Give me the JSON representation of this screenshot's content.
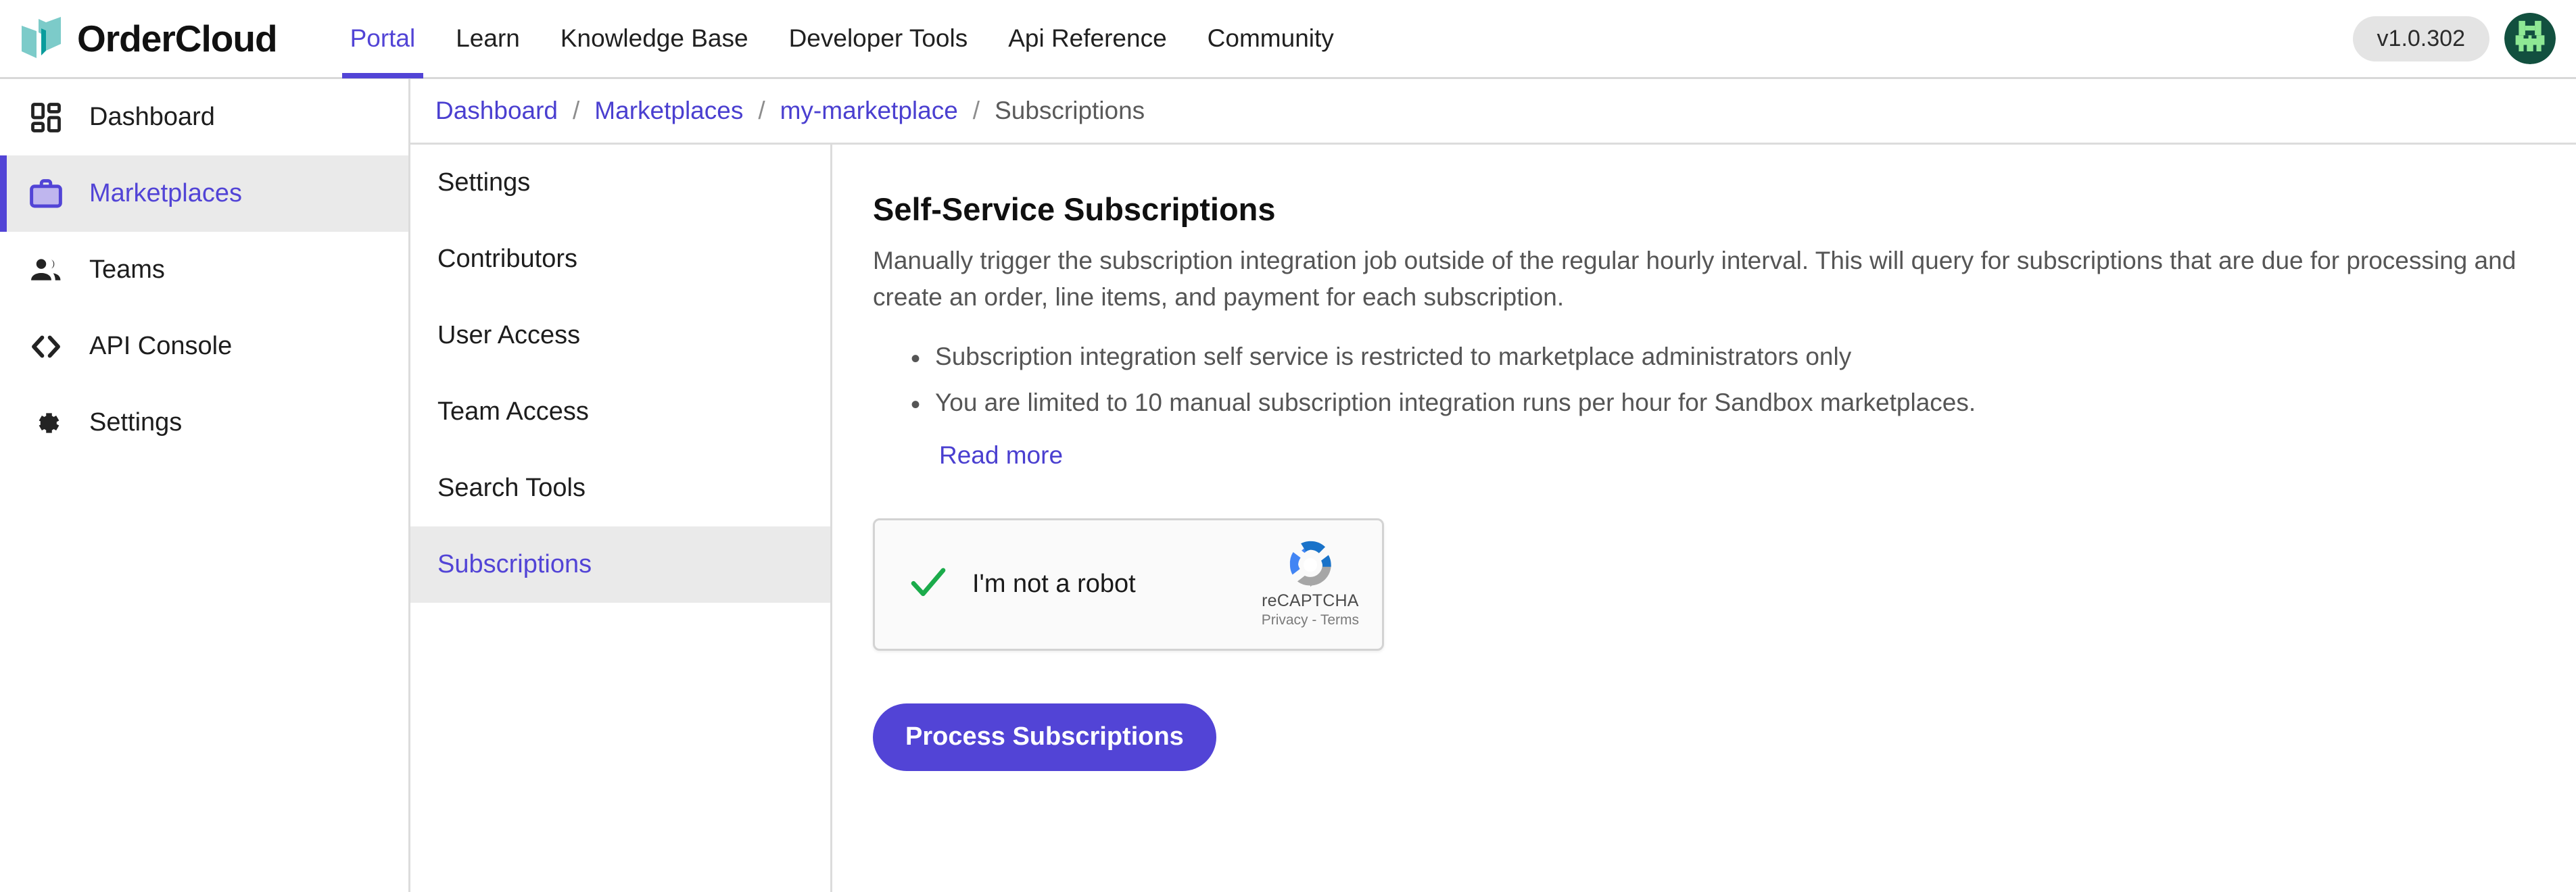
{
  "brand": {
    "name": "OrderCloud",
    "logo_icon": "ordercloud-book-logo",
    "logo_color_light": "#7ccbc9",
    "logo_color_dark": "#099c9c"
  },
  "topnav": {
    "items": [
      {
        "label": "Portal",
        "active": true
      },
      {
        "label": "Learn",
        "active": false
      },
      {
        "label": "Knowledge Base",
        "active": false
      },
      {
        "label": "Developer Tools",
        "active": false
      },
      {
        "label": "Api Reference",
        "active": false
      },
      {
        "label": "Community",
        "active": false
      }
    ],
    "version": "v1.0.302",
    "avatar_icon": "user-avatar-identicon"
  },
  "sidebar": {
    "items": [
      {
        "label": "Dashboard",
        "icon": "dashboard-grid-icon",
        "active": false
      },
      {
        "label": "Marketplaces",
        "icon": "briefcase-icon",
        "active": true
      },
      {
        "label": "Teams",
        "icon": "people-icon",
        "active": false
      },
      {
        "label": "API Console",
        "icon": "code-brackets-icon",
        "active": false
      },
      {
        "label": "Settings",
        "icon": "gear-icon",
        "active": false
      }
    ]
  },
  "breadcrumb": {
    "separator": "/",
    "items": [
      {
        "label": "Dashboard",
        "current": false
      },
      {
        "label": "Marketplaces",
        "current": false
      },
      {
        "label": "my-marketplace",
        "current": false
      },
      {
        "label": "Subscriptions",
        "current": true
      }
    ]
  },
  "subnav": {
    "items": [
      {
        "label": "Settings",
        "active": false
      },
      {
        "label": "Contributors",
        "active": false
      },
      {
        "label": "User Access",
        "active": false
      },
      {
        "label": "Team Access",
        "active": false
      },
      {
        "label": "Search Tools",
        "active": false
      },
      {
        "label": "Subscriptions",
        "active": true
      }
    ]
  },
  "main": {
    "title": "Self-Service Subscriptions",
    "description": "Manually trigger the subscription integration job outside of the regular hourly interval. This will query for subscriptions that are due for processing and create an order, line items, and payment for each subscription.",
    "bullet_glyph": "•",
    "notes": [
      "Subscription integration self service is restricted to marketplace administrators only",
      "You are limited to 10 manual subscription integration runs per hour for Sandbox marketplaces."
    ],
    "read_more_label": "Read more",
    "recaptcha": {
      "label": "I'm not a robot",
      "brand_name": "reCAPTCHA",
      "legal": "Privacy - Terms",
      "checked": true,
      "check_icon": "green-checkmark-icon",
      "logo_icon": "recaptcha-logo-icon",
      "check_color": "#1bab4b"
    },
    "submit_label": "Process Subscriptions"
  },
  "colors": {
    "accent": "#5244d6",
    "link": "#4a3fd0",
    "muted_text": "#555555",
    "active_bg": "#eaeaea"
  }
}
